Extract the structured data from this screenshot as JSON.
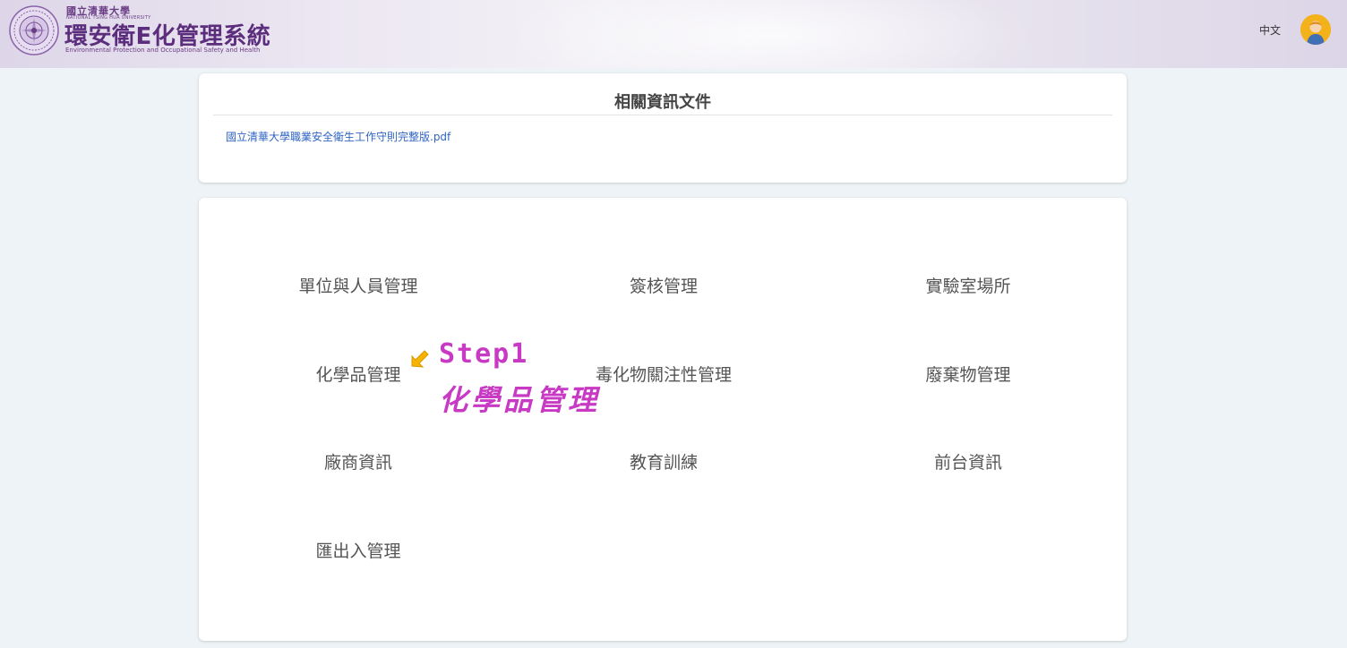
{
  "header": {
    "brand_small": "國立清華大學",
    "brand_univ": "NATIONAL TSING HUA UNIVERSITY",
    "title": "環安衛E化管理系統",
    "subtitle": "Environmental Protection and Occupational Safety and Health",
    "language": "中文",
    "logo_icon": "university-seal-icon",
    "avatar_icon": "user-avatar-icon"
  },
  "docs": {
    "title": "相關資訊文件",
    "files": [
      "國立清華大學職業安全衛生工作守則完整版.pdf"
    ]
  },
  "menu": {
    "items": [
      {
        "label": "單位與人員管理"
      },
      {
        "label": "簽核管理"
      },
      {
        "label": "實驗室場所"
      },
      {
        "label": "化學品管理"
      },
      {
        "label": "毒化物關注性管理"
      },
      {
        "label": "廢棄物管理"
      },
      {
        "label": "廠商資訊"
      },
      {
        "label": "教育訓練"
      },
      {
        "label": "前台資訊"
      },
      {
        "label": "匯出入管理"
      }
    ]
  },
  "annotation": {
    "step": "Step1",
    "name": "化學品管理",
    "color": "#c93ac4",
    "arrow_color": "#f5b400"
  },
  "colors": {
    "link": "#2f64c4",
    "brand": "#5b2d7c",
    "background": "#edf3f6"
  }
}
